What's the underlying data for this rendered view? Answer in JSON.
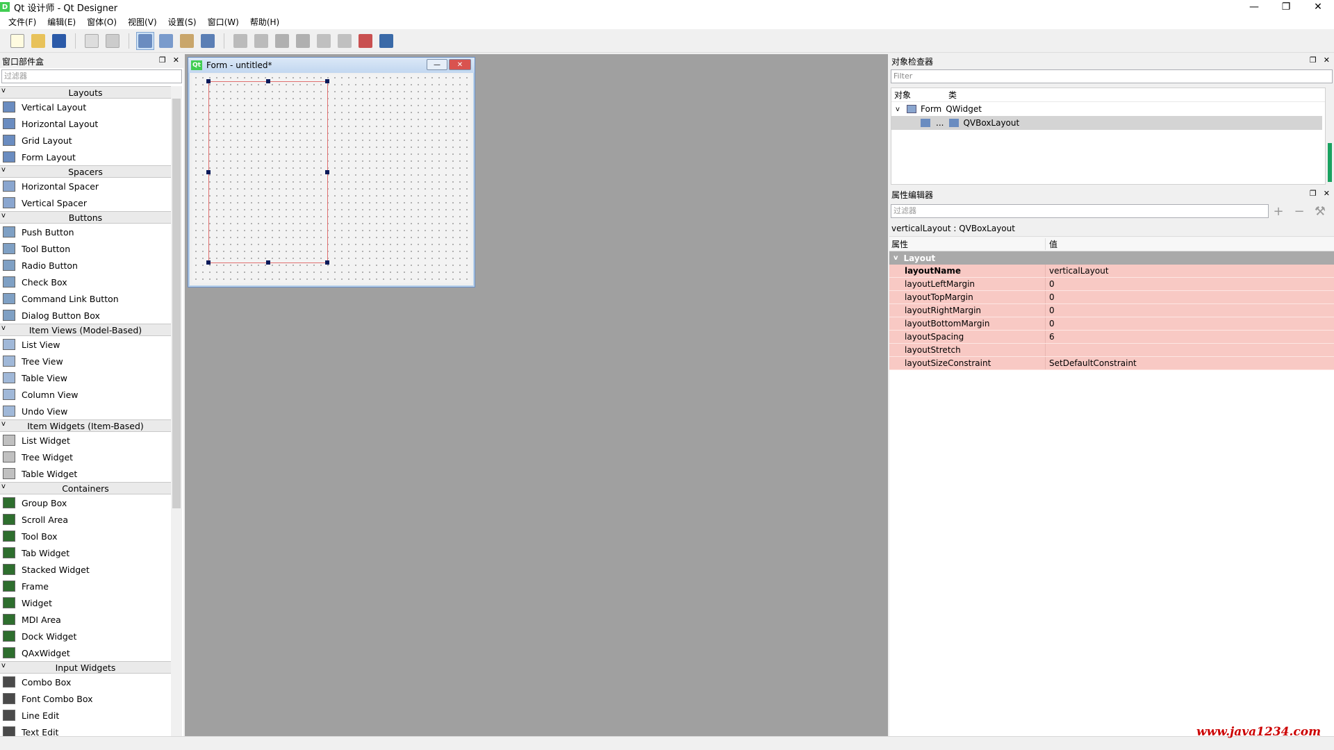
{
  "app": {
    "title": "Qt 设计师 - Qt Designer",
    "icon_label": "D",
    "controls": [
      "—",
      "❐",
      "✕"
    ]
  },
  "menu": [
    "文件(F)",
    "编辑(E)",
    "窗体(O)",
    "视图(V)",
    "设置(S)",
    "窗口(W)",
    "帮助(H)"
  ],
  "widget_box": {
    "title": "窗口部件盒",
    "filter_placeholder": "过滤器",
    "categories": [
      {
        "name": "Layouts",
        "items": [
          "Vertical Layout",
          "Horizontal Layout",
          "Grid Layout",
          "Form Layout"
        ]
      },
      {
        "name": "Spacers",
        "items": [
          "Horizontal Spacer",
          "Vertical Spacer"
        ]
      },
      {
        "name": "Buttons",
        "items": [
          "Push Button",
          "Tool Button",
          "Radio Button",
          "Check Box",
          "Command Link Button",
          "Dialog Button Box"
        ]
      },
      {
        "name": "Item Views (Model-Based)",
        "items": [
          "List View",
          "Tree View",
          "Table View",
          "Column View",
          "Undo View"
        ]
      },
      {
        "name": "Item Widgets (Item-Based)",
        "items": [
          "List Widget",
          "Tree Widget",
          "Table Widget"
        ]
      },
      {
        "name": "Containers",
        "items": [
          "Group Box",
          "Scroll Area",
          "Tool Box",
          "Tab Widget",
          "Stacked Widget",
          "Frame",
          "Widget",
          "MDI Area",
          "Dock Widget",
          "QAxWidget"
        ]
      },
      {
        "name": "Input Widgets",
        "items": [
          "Combo Box",
          "Font Combo Box",
          "Line Edit",
          "Text Edit"
        ]
      }
    ]
  },
  "form": {
    "title": "Form - untitled*",
    "icon_label": "Qt"
  },
  "object_inspector": {
    "title": "对象检查器",
    "filter_placeholder": "Filter",
    "col_object": "对象",
    "col_class": "类",
    "rows": [
      {
        "object": "Form",
        "class": "QWidget"
      },
      {
        "object": "...",
        "class": "QVBoxLayout"
      }
    ]
  },
  "property_editor": {
    "title": "属性编辑器",
    "filter_placeholder": "过滤器",
    "class_line": "verticalLayout : QVBoxLayout",
    "col_property": "属性",
    "col_value": "值",
    "group": "Layout",
    "rows": [
      {
        "name": "layoutName",
        "value": "verticalLayout"
      },
      {
        "name": "layoutLeftMargin",
        "value": "0"
      },
      {
        "name": "layoutTopMargin",
        "value": "0"
      },
      {
        "name": "layoutRightMargin",
        "value": "0"
      },
      {
        "name": "layoutBottomMargin",
        "value": "0"
      },
      {
        "name": "layoutSpacing",
        "value": "6"
      },
      {
        "name": "layoutStretch",
        "value": ""
      },
      {
        "name": "layoutSizeConstraint",
        "value": "SetDefaultConstraint"
      }
    ]
  },
  "watermark": "www.java1234.com",
  "colors": {
    "accent_green": "#41cd52",
    "property_highlight": "#f8c9c4",
    "layout_outline": "#e07070",
    "mdi_background": "#a0a0a0"
  }
}
